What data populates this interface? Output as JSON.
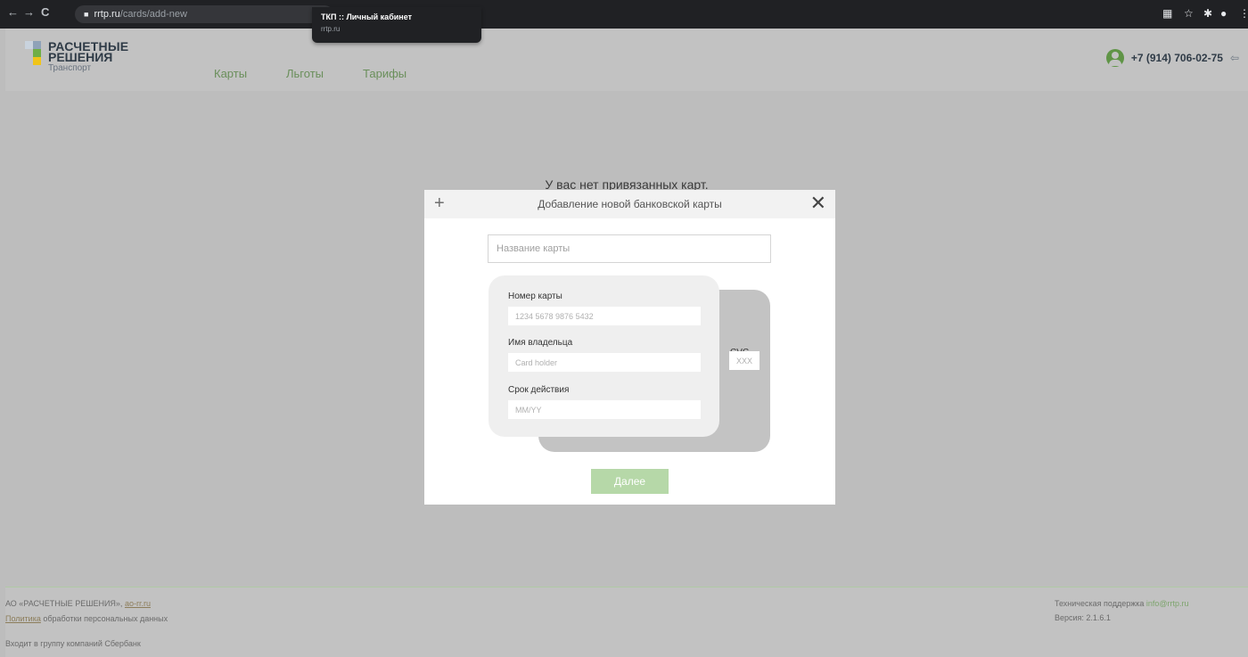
{
  "browser": {
    "url_host": "rrtp.ru",
    "url_path": "/cards/add-new",
    "tab_title": "ТКП :: Личный кабинет",
    "tab_subtitle": "rrtp.ru"
  },
  "header": {
    "logo": {
      "line1": "РАСЧЕТНЫЕ",
      "line2": "РЕШЕНИЯ",
      "line3": "Транспорт"
    },
    "nav": [
      "Карты",
      "Льготы",
      "Тарифы"
    ],
    "phone": "+7 (914) 706-02-75"
  },
  "main": {
    "empty_message": "У вас нет привязанных карт."
  },
  "modal": {
    "title": "Добавление новой банковской карты",
    "name_placeholder": "Название карты",
    "card_number_label": "Номер карты",
    "card_number_placeholder": "1234 5678 9876 5432",
    "holder_label": "Имя владельца",
    "holder_placeholder": "Card holder",
    "expiry_label": "Срок действия",
    "expiry_placeholder": "MM/YY",
    "cvc_label": "CVC",
    "cvc_placeholder": "XXX",
    "next_label": "Далее"
  },
  "footer": {
    "company": "АО «РАСЧЕТНЫЕ РЕШЕНИЯ»,",
    "company_link": "ao-rr.ru",
    "policy_link": "Политика",
    "policy_text": "обработки персональных данных",
    "group": "Входит в группу компаний Сбербанк",
    "support_label": "Техническая поддержка",
    "support_email": "info@rrtp.ru",
    "version": "Версия: 2.1.6.1"
  },
  "colors": {
    "accent_green": "#5f9446",
    "button_green": "#b6d8a8",
    "overlay_gray": "#bdbdbd"
  }
}
